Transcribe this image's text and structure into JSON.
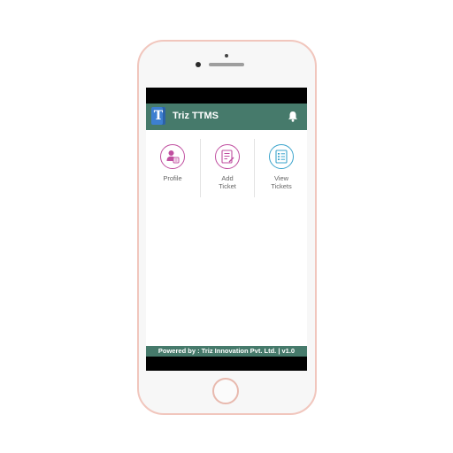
{
  "app": {
    "title": "Triz TTMS",
    "logo_letter": "T",
    "accent_color": "#467a6b"
  },
  "menu": {
    "items": [
      {
        "label": "Profile",
        "icon": "user-profile-icon",
        "color": "#c04fa0"
      },
      {
        "label": "Add\nTicket",
        "icon": "add-ticket-icon",
        "color": "#c04fa0"
      },
      {
        "label": "View\nTickets",
        "icon": "view-tickets-icon",
        "color": "#3ba4cc"
      }
    ]
  },
  "footer": {
    "text": "Powered by : Triz Innovation Pvt. Ltd. | v1.0"
  }
}
